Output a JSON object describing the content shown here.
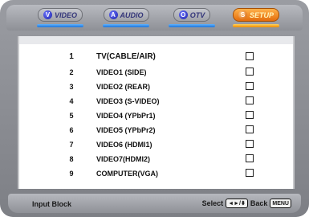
{
  "tabs": [
    {
      "letter": "V",
      "label": "VIDEO",
      "active": false
    },
    {
      "letter": "A",
      "label": "AUDIO",
      "active": false
    },
    {
      "letter": "O",
      "label": "OTV",
      "active": false
    },
    {
      "letter": "S",
      "label": "SETUP",
      "active": true
    }
  ],
  "rows": [
    {
      "num": "1",
      "label": "TV(CABLE/AIR)"
    },
    {
      "num": "2",
      "label": "VIDEO1 (SIDE)"
    },
    {
      "num": "3",
      "label": "VIDEO2 (REAR)"
    },
    {
      "num": "4",
      "label": "VIDEO3 (S-VIDEO)"
    },
    {
      "num": "5",
      "label": "VIDEO4 (YPbPr1)"
    },
    {
      "num": "6",
      "label": "VIDEO5 (YPbPr2)"
    },
    {
      "num": "7",
      "label": "VIDEO6 (HDMI1)"
    },
    {
      "num": "8",
      "label": "VIDEO7(HDMI2)"
    },
    {
      "num": "9",
      "label": "COMPUTER(VGA)"
    }
  ],
  "footer": {
    "title": "Input Block",
    "select_label": "Select",
    "select_keys": "◄►/⬍",
    "back_label": "Back",
    "back_key": "MENU"
  }
}
